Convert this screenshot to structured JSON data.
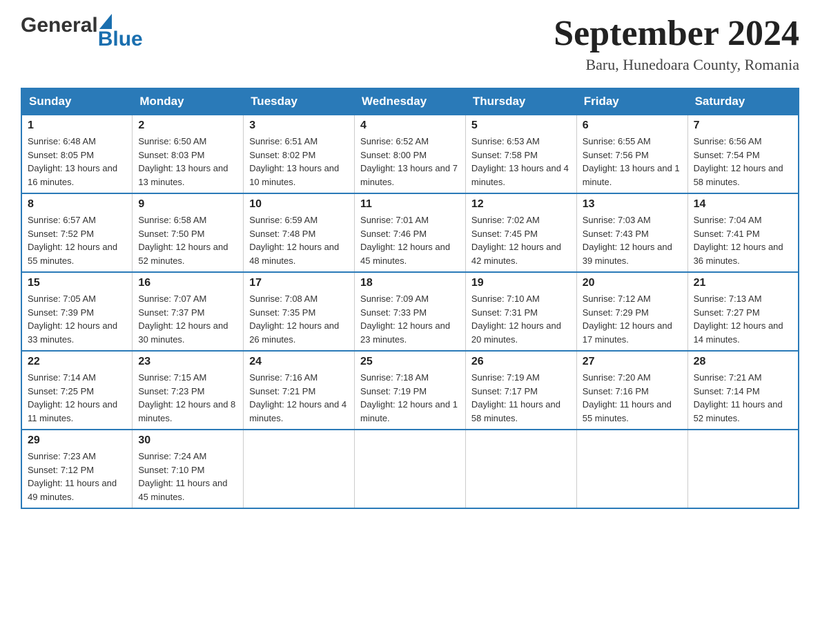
{
  "logo": {
    "general": "General",
    "blue": "Blue"
  },
  "title": "September 2024",
  "subtitle": "Baru, Hunedoara County, Romania",
  "headers": [
    "Sunday",
    "Monday",
    "Tuesday",
    "Wednesday",
    "Thursday",
    "Friday",
    "Saturday"
  ],
  "weeks": [
    [
      {
        "day": "1",
        "sunrise": "Sunrise: 6:48 AM",
        "sunset": "Sunset: 8:05 PM",
        "daylight": "Daylight: 13 hours and 16 minutes."
      },
      {
        "day": "2",
        "sunrise": "Sunrise: 6:50 AM",
        "sunset": "Sunset: 8:03 PM",
        "daylight": "Daylight: 13 hours and 13 minutes."
      },
      {
        "day": "3",
        "sunrise": "Sunrise: 6:51 AM",
        "sunset": "Sunset: 8:02 PM",
        "daylight": "Daylight: 13 hours and 10 minutes."
      },
      {
        "day": "4",
        "sunrise": "Sunrise: 6:52 AM",
        "sunset": "Sunset: 8:00 PM",
        "daylight": "Daylight: 13 hours and 7 minutes."
      },
      {
        "day": "5",
        "sunrise": "Sunrise: 6:53 AM",
        "sunset": "Sunset: 7:58 PM",
        "daylight": "Daylight: 13 hours and 4 minutes."
      },
      {
        "day": "6",
        "sunrise": "Sunrise: 6:55 AM",
        "sunset": "Sunset: 7:56 PM",
        "daylight": "Daylight: 13 hours and 1 minute."
      },
      {
        "day": "7",
        "sunrise": "Sunrise: 6:56 AM",
        "sunset": "Sunset: 7:54 PM",
        "daylight": "Daylight: 12 hours and 58 minutes."
      }
    ],
    [
      {
        "day": "8",
        "sunrise": "Sunrise: 6:57 AM",
        "sunset": "Sunset: 7:52 PM",
        "daylight": "Daylight: 12 hours and 55 minutes."
      },
      {
        "day": "9",
        "sunrise": "Sunrise: 6:58 AM",
        "sunset": "Sunset: 7:50 PM",
        "daylight": "Daylight: 12 hours and 52 minutes."
      },
      {
        "day": "10",
        "sunrise": "Sunrise: 6:59 AM",
        "sunset": "Sunset: 7:48 PM",
        "daylight": "Daylight: 12 hours and 48 minutes."
      },
      {
        "day": "11",
        "sunrise": "Sunrise: 7:01 AM",
        "sunset": "Sunset: 7:46 PM",
        "daylight": "Daylight: 12 hours and 45 minutes."
      },
      {
        "day": "12",
        "sunrise": "Sunrise: 7:02 AM",
        "sunset": "Sunset: 7:45 PM",
        "daylight": "Daylight: 12 hours and 42 minutes."
      },
      {
        "day": "13",
        "sunrise": "Sunrise: 7:03 AM",
        "sunset": "Sunset: 7:43 PM",
        "daylight": "Daylight: 12 hours and 39 minutes."
      },
      {
        "day": "14",
        "sunrise": "Sunrise: 7:04 AM",
        "sunset": "Sunset: 7:41 PM",
        "daylight": "Daylight: 12 hours and 36 minutes."
      }
    ],
    [
      {
        "day": "15",
        "sunrise": "Sunrise: 7:05 AM",
        "sunset": "Sunset: 7:39 PM",
        "daylight": "Daylight: 12 hours and 33 minutes."
      },
      {
        "day": "16",
        "sunrise": "Sunrise: 7:07 AM",
        "sunset": "Sunset: 7:37 PM",
        "daylight": "Daylight: 12 hours and 30 minutes."
      },
      {
        "day": "17",
        "sunrise": "Sunrise: 7:08 AM",
        "sunset": "Sunset: 7:35 PM",
        "daylight": "Daylight: 12 hours and 26 minutes."
      },
      {
        "day": "18",
        "sunrise": "Sunrise: 7:09 AM",
        "sunset": "Sunset: 7:33 PM",
        "daylight": "Daylight: 12 hours and 23 minutes."
      },
      {
        "day": "19",
        "sunrise": "Sunrise: 7:10 AM",
        "sunset": "Sunset: 7:31 PM",
        "daylight": "Daylight: 12 hours and 20 minutes."
      },
      {
        "day": "20",
        "sunrise": "Sunrise: 7:12 AM",
        "sunset": "Sunset: 7:29 PM",
        "daylight": "Daylight: 12 hours and 17 minutes."
      },
      {
        "day": "21",
        "sunrise": "Sunrise: 7:13 AM",
        "sunset": "Sunset: 7:27 PM",
        "daylight": "Daylight: 12 hours and 14 minutes."
      }
    ],
    [
      {
        "day": "22",
        "sunrise": "Sunrise: 7:14 AM",
        "sunset": "Sunset: 7:25 PM",
        "daylight": "Daylight: 12 hours and 11 minutes."
      },
      {
        "day": "23",
        "sunrise": "Sunrise: 7:15 AM",
        "sunset": "Sunset: 7:23 PM",
        "daylight": "Daylight: 12 hours and 8 minutes."
      },
      {
        "day": "24",
        "sunrise": "Sunrise: 7:16 AM",
        "sunset": "Sunset: 7:21 PM",
        "daylight": "Daylight: 12 hours and 4 minutes."
      },
      {
        "day": "25",
        "sunrise": "Sunrise: 7:18 AM",
        "sunset": "Sunset: 7:19 PM",
        "daylight": "Daylight: 12 hours and 1 minute."
      },
      {
        "day": "26",
        "sunrise": "Sunrise: 7:19 AM",
        "sunset": "Sunset: 7:17 PM",
        "daylight": "Daylight: 11 hours and 58 minutes."
      },
      {
        "day": "27",
        "sunrise": "Sunrise: 7:20 AM",
        "sunset": "Sunset: 7:16 PM",
        "daylight": "Daylight: 11 hours and 55 minutes."
      },
      {
        "day": "28",
        "sunrise": "Sunrise: 7:21 AM",
        "sunset": "Sunset: 7:14 PM",
        "daylight": "Daylight: 11 hours and 52 minutes."
      }
    ],
    [
      {
        "day": "29",
        "sunrise": "Sunrise: 7:23 AM",
        "sunset": "Sunset: 7:12 PM",
        "daylight": "Daylight: 11 hours and 49 minutes."
      },
      {
        "day": "30",
        "sunrise": "Sunrise: 7:24 AM",
        "sunset": "Sunset: 7:10 PM",
        "daylight": "Daylight: 11 hours and 45 minutes."
      },
      null,
      null,
      null,
      null,
      null
    ]
  ]
}
